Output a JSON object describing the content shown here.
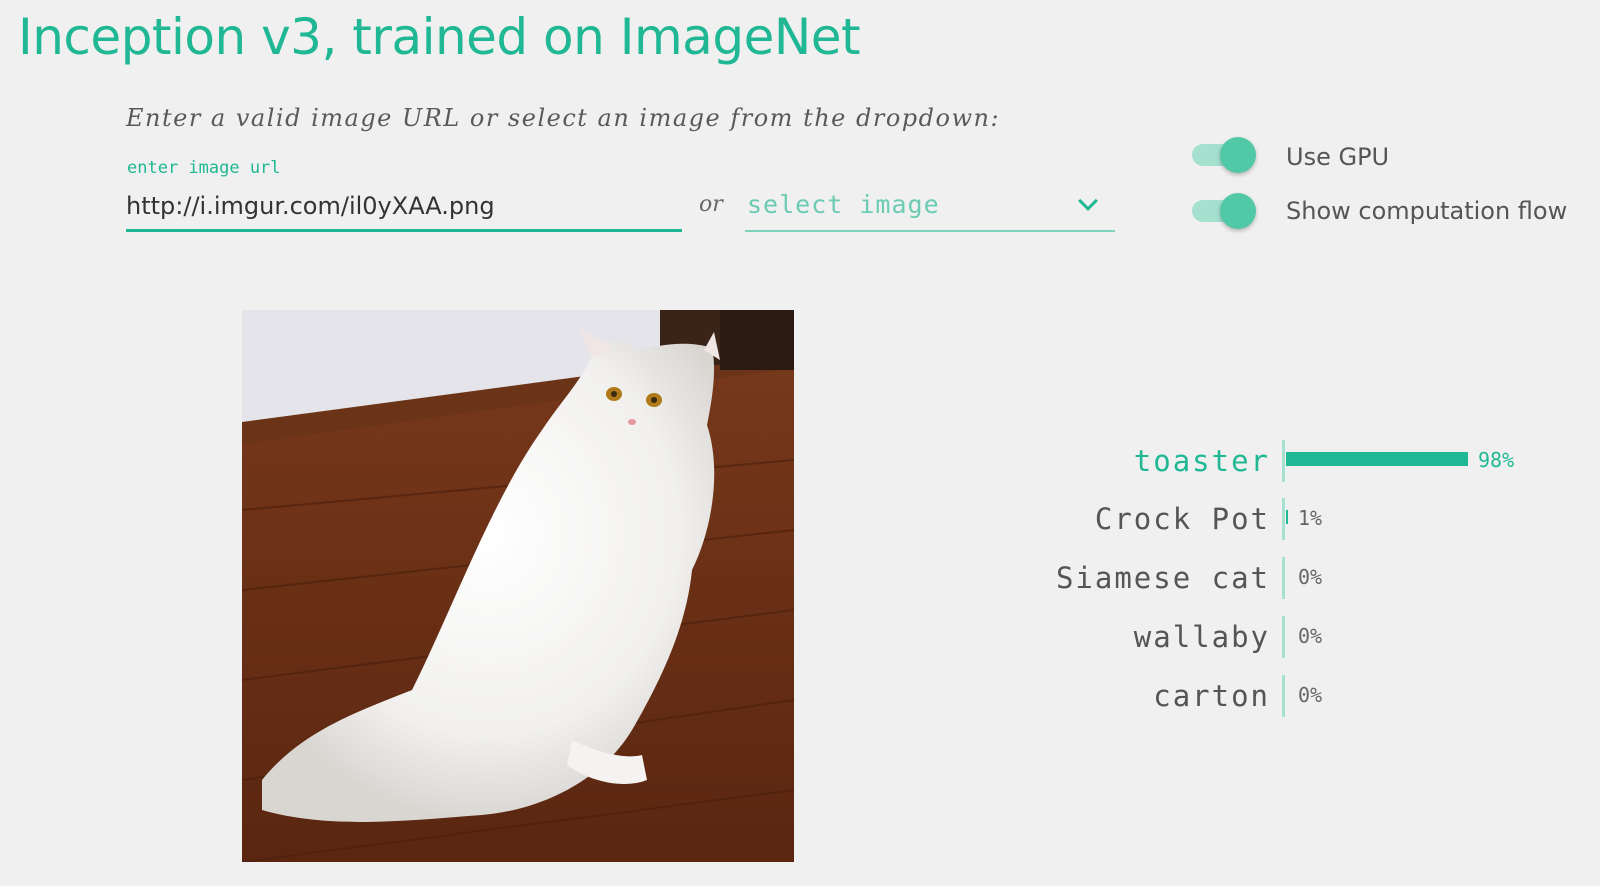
{
  "title": "Inception v3, trained on ImageNet",
  "instructions": "Enter a valid image URL or select an image from the dropdown:",
  "url_input": {
    "label": "enter image url",
    "value": "http://i.imgur.com/il0yXAA.png"
  },
  "or_text": "or",
  "select": {
    "placeholder": "select image"
  },
  "toggles": [
    {
      "label": "Use GPU",
      "on": true
    },
    {
      "label": "Show computation flow",
      "on": true
    }
  ],
  "colors": {
    "accent": "#20b894",
    "accent_light": "#a6e0cf",
    "background": "#f0f0f0"
  },
  "predictions": [
    {
      "label": "toaster",
      "percent": 98,
      "percent_text": "98%"
    },
    {
      "label": "Crock Pot",
      "percent": 1,
      "percent_text": "1%"
    },
    {
      "label": "Siamese cat",
      "percent": 0,
      "percent_text": "0%"
    },
    {
      "label": "wallaby",
      "percent": 0,
      "percent_text": "0%"
    },
    {
      "label": "carton",
      "percent": 0,
      "percent_text": "0%"
    }
  ]
}
